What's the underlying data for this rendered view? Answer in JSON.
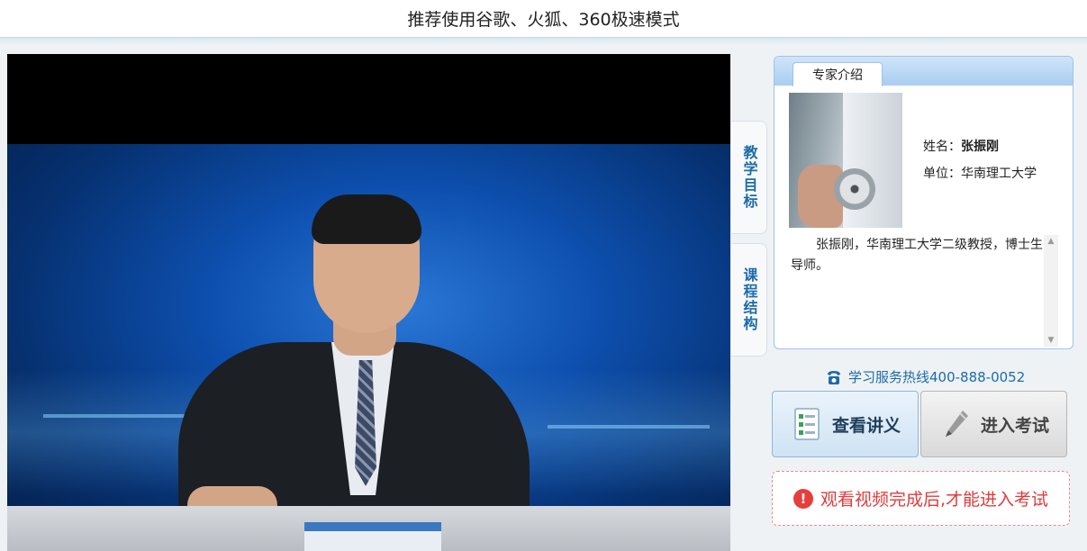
{
  "banner": {
    "text": "推荐使用谷歌、火狐、360极速模式"
  },
  "side_tabs": [
    {
      "label": "教学目标"
    },
    {
      "label": "课程结构"
    }
  ],
  "expert": {
    "tab_label": "专家介绍",
    "name_label": "姓名：",
    "name": "张振刚",
    "unit_label": "单位：",
    "unit": "华南理工大学",
    "bio": "张振刚，华南理工大学二级教授，博士生导师。"
  },
  "hotline": {
    "text": "学习服务热线400-888-0052"
  },
  "buttons": {
    "notes": "查看讲义",
    "exam": "进入考试"
  },
  "warning": {
    "text": "观看视频完成后,才能进入考试"
  },
  "colors": {
    "accent": "#1d6ba8",
    "warning": "#e03c3c",
    "panel_border": "#9fc3e6"
  },
  "icons": {
    "phone": "phone-icon",
    "notes": "document-icon",
    "exam": "pencil-icon",
    "warning": "exclamation-icon"
  }
}
